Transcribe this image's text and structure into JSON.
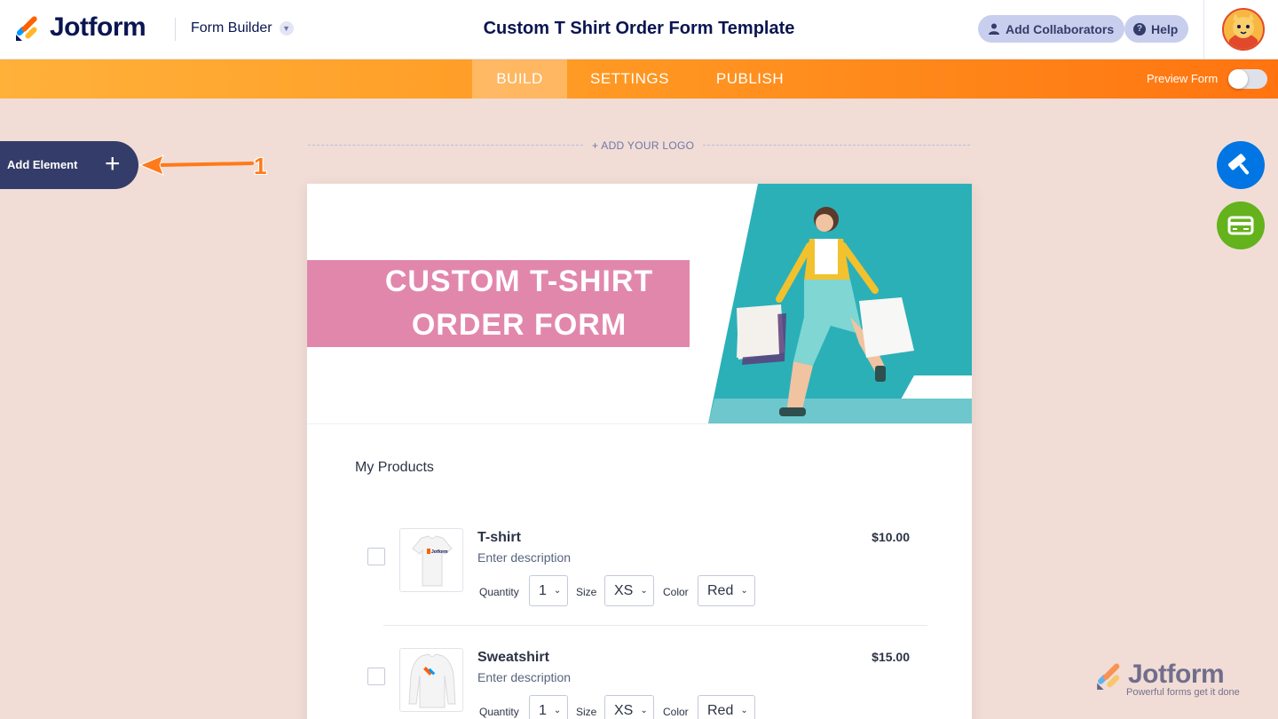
{
  "header": {
    "logo_text": "Jotform",
    "builder_label": "Form Builder",
    "form_title": "Custom T Shirt Order Form Template",
    "collaborators_label": "Add Collaborators",
    "help_label": "Help"
  },
  "nav": {
    "tabs": [
      {
        "label": "BUILD",
        "active": true
      },
      {
        "label": "SETTINGS",
        "active": false
      },
      {
        "label": "PUBLISH",
        "active": false
      }
    ],
    "preview_label": "Preview Form",
    "preview_on": false
  },
  "sidebar": {
    "add_element_label": "Add Element",
    "annotation_number": "1"
  },
  "form": {
    "add_logo_label": "+ ADD YOUR LOGO",
    "hero_line1": "CUSTOM T-SHIRT",
    "hero_line2": "ORDER FORM",
    "section_title": "My Products",
    "products": [
      {
        "name": "T-shirt",
        "description": "Enter description",
        "price": "$10.00",
        "quantity_label": "Quantity",
        "quantity": "1",
        "size_label": "Size",
        "size": "XS",
        "color_label": "Color",
        "color": "Red"
      },
      {
        "name": "Sweatshirt",
        "description": "Enter description",
        "price": "$15.00",
        "quantity_label": "Quantity",
        "quantity": "1",
        "size_label": "Size",
        "size": "XS",
        "color_label": "Color",
        "color": "Red"
      }
    ]
  },
  "watermark": {
    "brand": "Jotform",
    "tagline": "Powerful forms get it done"
  },
  "colors": {
    "nav_orange": "#ff7410",
    "add_element_bg": "#343c6a",
    "hero_pink": "#e287ac",
    "hero_teal": "#2bb0b8",
    "tool_blue": "#0075e3",
    "tool_green": "#64b21c"
  },
  "icons": {
    "collaborators": "user-icon",
    "help": "question-icon",
    "add": "plus-icon",
    "designer": "paint-roller-icon",
    "payment": "card-icon"
  }
}
